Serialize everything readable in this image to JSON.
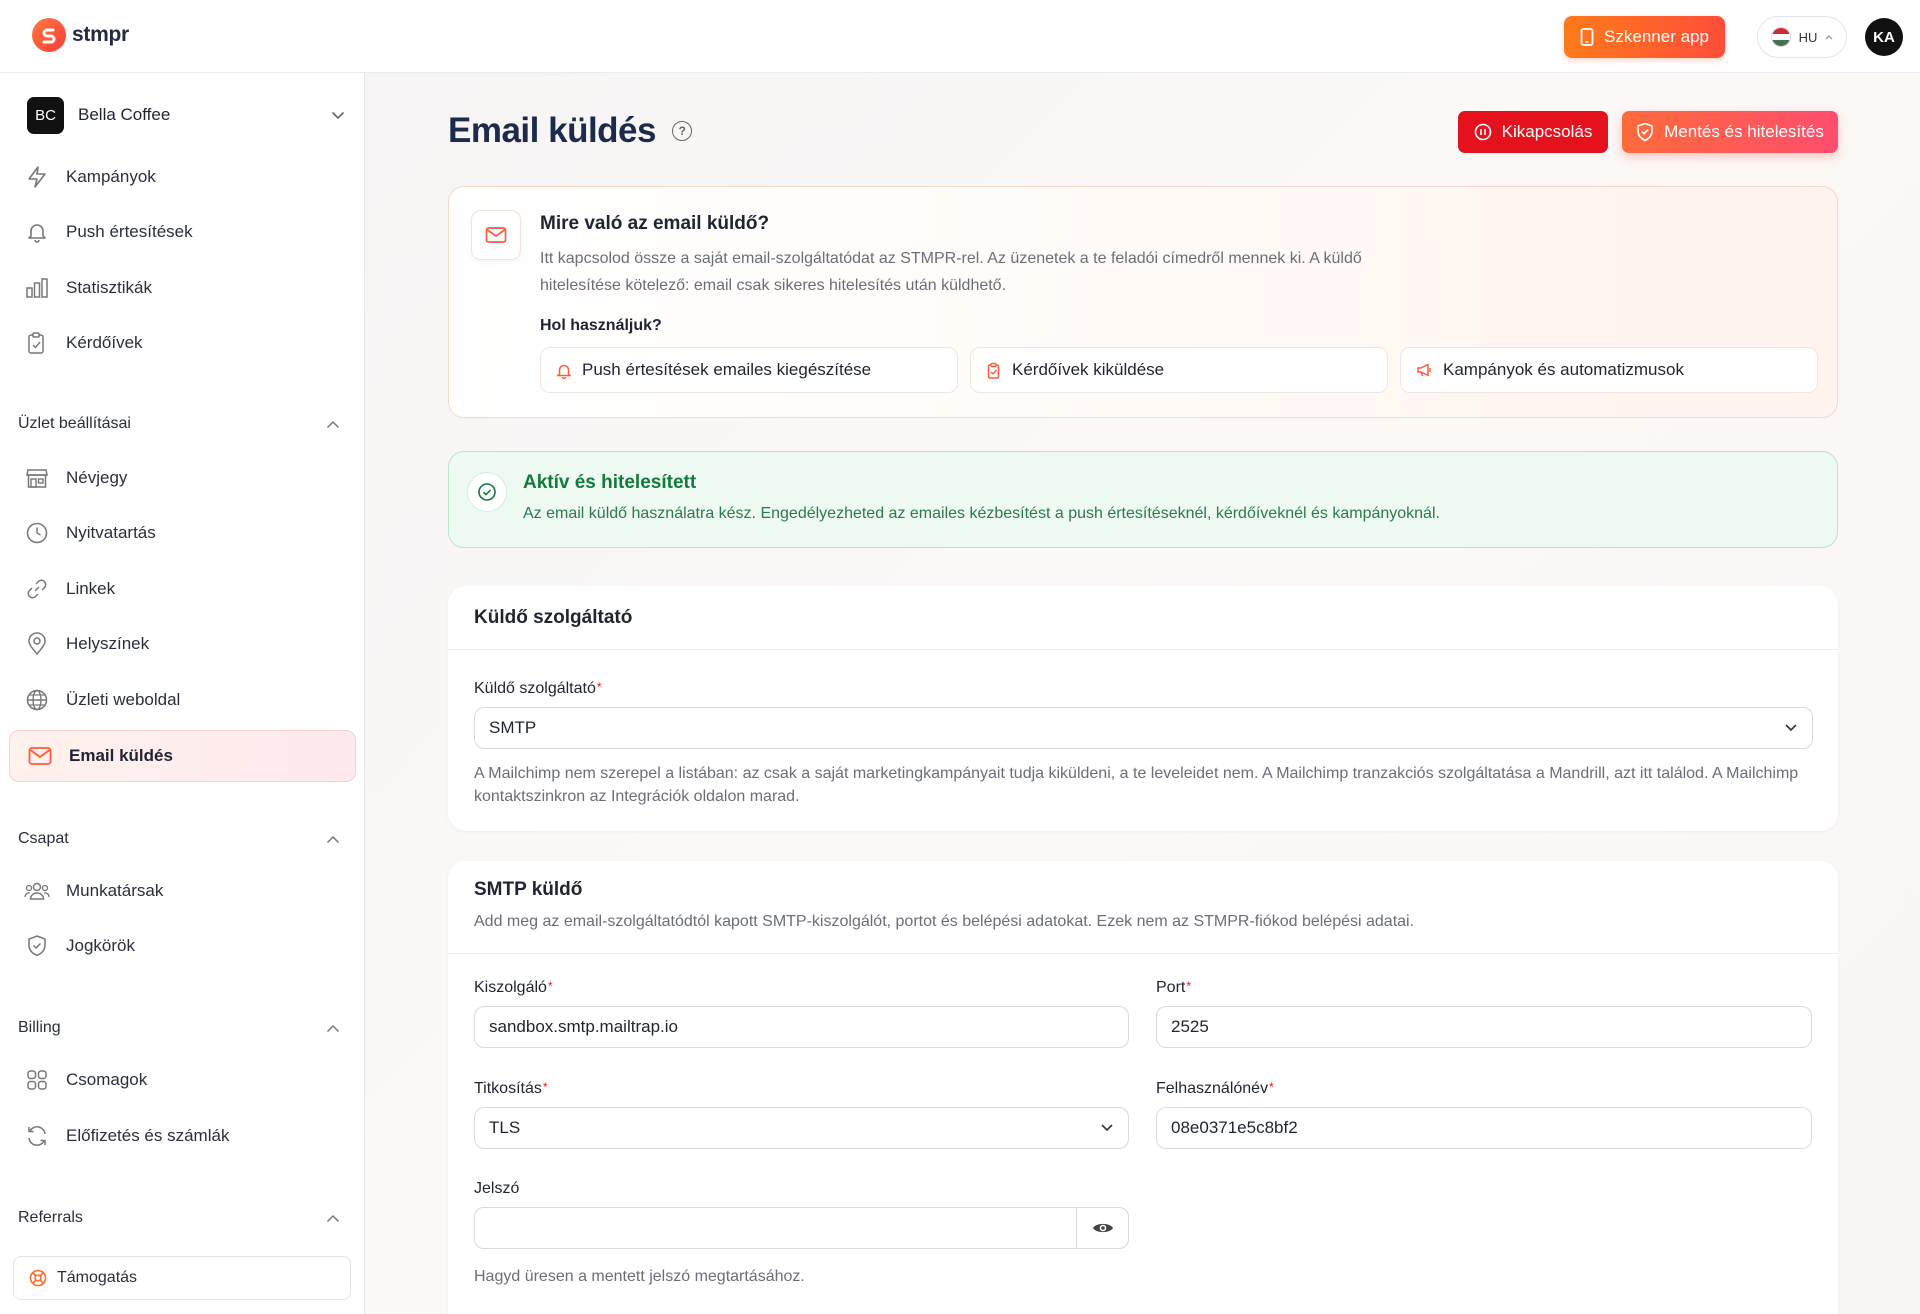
{
  "app": {
    "name": "stmpr"
  },
  "topbar": {
    "scanner_label": "Szkenner app",
    "lang": "HU",
    "avatar": "KA"
  },
  "sidebar": {
    "org_initials": "BC",
    "org_name": "Bella Coffee",
    "main_items": [
      {
        "label": "Kampányok",
        "icon": "lightning-icon"
      },
      {
        "label": "Push értesítések",
        "icon": "bell-icon"
      },
      {
        "label": "Statisztikák",
        "icon": "bar-chart-icon"
      },
      {
        "label": "Kérdőívek",
        "icon": "clipboard-icon"
      }
    ],
    "shop_section": "Üzlet beállításai",
    "shop_items": [
      {
        "label": "Névjegy",
        "icon": "store-icon"
      },
      {
        "label": "Nyitvatartás",
        "icon": "clock-icon"
      },
      {
        "label": "Linkek",
        "icon": "link-icon"
      },
      {
        "label": "Helyszínek",
        "icon": "map-pin-icon"
      },
      {
        "label": "Üzleti weboldal",
        "icon": "globe-icon"
      },
      {
        "label": "Email küldés",
        "icon": "mail-icon"
      }
    ],
    "team_section": "Csapat",
    "team_items": [
      {
        "label": "Munkatársak",
        "icon": "users-icon"
      },
      {
        "label": "Jogkörök",
        "icon": "shield-check-icon"
      }
    ],
    "billing_section": "Billing",
    "billing_items": [
      {
        "label": "Csomagok",
        "icon": "grid-icon"
      },
      {
        "label": "Előfizetés és számlák",
        "icon": "refresh-icon"
      }
    ],
    "referrals_section": "Referrals",
    "support_label": "Támogatás"
  },
  "page": {
    "title": "Email küldés",
    "disable_label": "Kikapcsolás",
    "save_label": "Mentés és hitelesítés"
  },
  "info": {
    "title": "Mire való az email küldő?",
    "text": "Itt kapcsolod össze a saját email-szolgáltatódat az STMPR-rel. Az üzenetek a te feladói címedről mennek ki. A küldő hitelesítése kötelező: email csak sikeres hitelesítés után küldhető.",
    "where_title": "Hol használjuk?",
    "chips": [
      "Push értesítések emailes kiegészítése",
      "Kérdőívek kiküldése",
      "Kampányok és automatizmusok"
    ]
  },
  "status": {
    "title": "Aktív és hitelesített",
    "text": "Az email küldő használatra kész. Engedélyezheted az emailes kézbesítést a push értesítéseknél, kérdőíveknél és kampányoknál."
  },
  "provider_card": {
    "title": "Küldő szolgáltató",
    "field_label": "Küldő szolgáltató",
    "value": "SMTP",
    "hint": "A Mailchimp nem szerepel a listában: az csak a saját marketingkampányait tudja kiküldeni, a te leveleidet nem. A Mailchimp tranzakciós szolgáltatása a Mandrill, azt itt találod. A Mailchimp kontaktszinkron az Integrációk oldalon marad."
  },
  "smtp_card": {
    "title": "SMTP küldő",
    "subtitle": "Add meg az email-szolgáltatódtól kapott SMTP-kiszolgálót, portot és belépési adatokat. Ezek nem az STMPR-fiókod belépési adatai.",
    "host_label": "Kiszolgáló",
    "host_value": "sandbox.smtp.mailtrap.io",
    "port_label": "Port",
    "port_value": "2525",
    "encryption_label": "Titkosítás",
    "encryption_value": "TLS",
    "username_label": "Felhasználónév",
    "username_value": "08e0371e5c8bf2",
    "password_label": "Jelszó",
    "password_value": "",
    "password_hint": "Hagyd üresen a mentett jelszó megtartásához."
  },
  "colors": {
    "accent": "#ff5a3c",
    "danger": "#e5111d",
    "success": "#137a3e"
  }
}
